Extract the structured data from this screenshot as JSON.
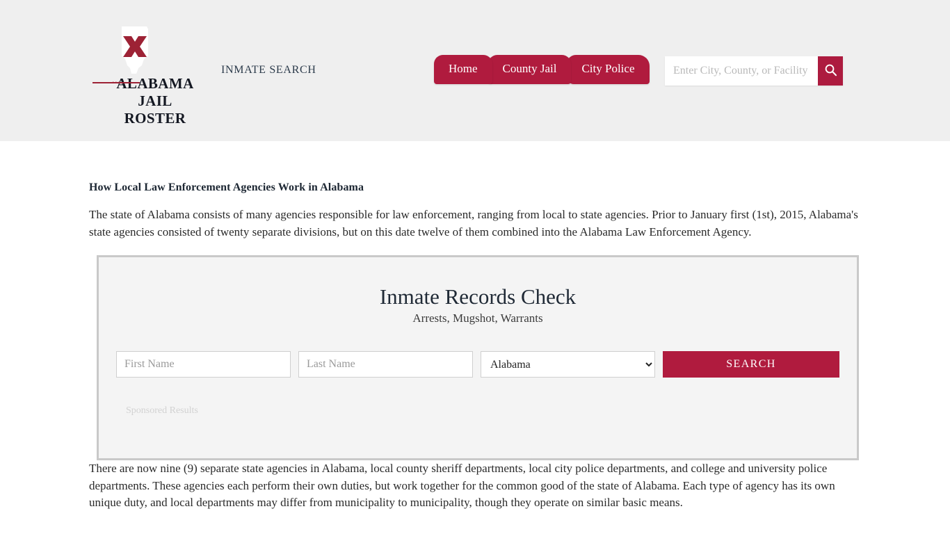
{
  "header": {
    "brand": {
      "line1": "ALABAMA",
      "line2": "JAIL ROSTER",
      "dots": "•••",
      "logo_icon": "alabama-state-outline-with-crimson-x",
      "colors": {
        "crimson": "#9d2235",
        "state": "#ffffff"
      }
    },
    "tagline": "INMATE SEARCH",
    "nav": [
      {
        "label": "Home",
        "name": "home"
      },
      {
        "label": "County Jail",
        "name": "county-jail"
      },
      {
        "label": "City Police",
        "name": "city-police"
      }
    ],
    "search": {
      "value": "",
      "placeholder": "Enter City, County, or Facility",
      "button_icon": "search-icon"
    },
    "background": "#efefef",
    "accent": "#b01b3e"
  },
  "main": {
    "article_heading": "How Local Law Enforcement Agencies Work in Alabama",
    "intro_paragraph": "The state of Alabama consists of many agencies responsible for law enforcement, ranging from local to state agencies. Prior to January first (1st), 2015, Alabama's state agencies consisted of twenty separate divisions, but on this date twelve of them combined into the Alabama Law Enforcement Agency.",
    "bottom_paragraph": "There are now nine (9) separate state agencies in Alabama, local county sheriff departments, local city police departments, and college and university police departments. These agencies each perform their own duties, but work together for the common good of the state of Alabama. Each type of agency has its own unique duty, and local departments may differ from municipality to municipality, though they operate on similar basic means."
  },
  "widget": {
    "title": "Inmate Records Check",
    "subtitle": "Arrests, Mugshot, Warrants",
    "first_name": {
      "value": "",
      "placeholder": "First Name"
    },
    "last_name": {
      "value": "",
      "placeholder": "Last Name"
    },
    "state": {
      "selected": "Alabama",
      "options": [
        "Alabama"
      ]
    },
    "submit_label": "SEARCH",
    "sponsored_label": "Sponsored Results",
    "accent": "#b01b3e",
    "border_color": "#c9c9c9",
    "background": "#f4f4f4"
  }
}
